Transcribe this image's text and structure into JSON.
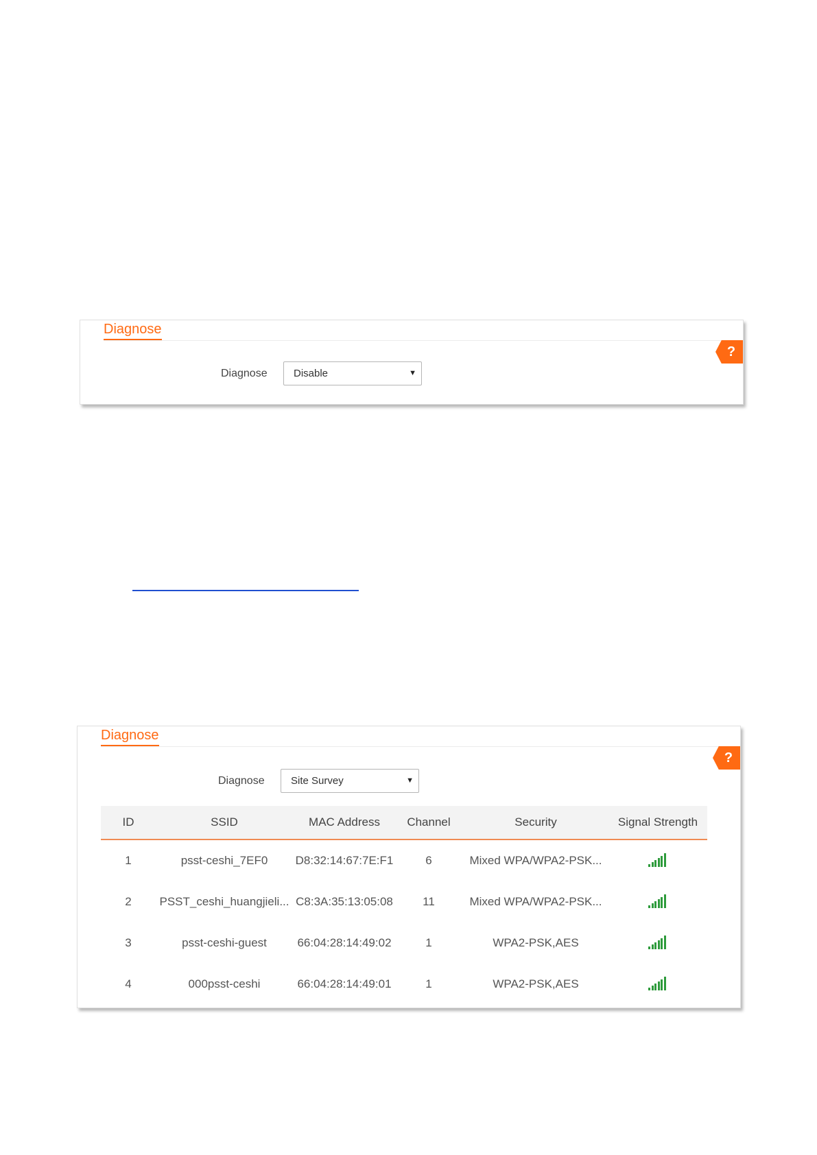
{
  "panel_top": {
    "title": "Diagnose",
    "help": "?",
    "field_label": "Diagnose",
    "select_value": "Disable"
  },
  "panel_bottom": {
    "title": "Diagnose",
    "help": "?",
    "field_label": "Diagnose",
    "select_value": "Site Survey",
    "table": {
      "headers": [
        "ID",
        "SSID",
        "MAC Address",
        "Channel",
        "Security",
        "Signal Strength"
      ],
      "rows": [
        {
          "id": "1",
          "ssid": "psst-ceshi_7EF0",
          "mac": "D8:32:14:67:7E:F1",
          "channel": "6",
          "security": "Mixed WPA/WPA2-PSK...",
          "signal_icon": "signal-full-icon"
        },
        {
          "id": "2",
          "ssid": "PSST_ceshi_huangjieli...",
          "mac": "C8:3A:35:13:05:08",
          "channel": "11",
          "security": "Mixed WPA/WPA2-PSK...",
          "signal_icon": "signal-full-icon"
        },
        {
          "id": "3",
          "ssid": "psst-ceshi-guest",
          "mac": "66:04:28:14:49:02",
          "channel": "1",
          "security": "WPA2-PSK,AES",
          "signal_icon": "signal-full-icon"
        },
        {
          "id": "4",
          "ssid": "000psst-ceshi",
          "mac": "66:04:28:14:49:01",
          "channel": "1",
          "security": "WPA2-PSK,AES",
          "signal_icon": "signal-full-icon"
        }
      ]
    }
  },
  "colors": {
    "accent": "#ff6a13",
    "signal": "#2e9b3c",
    "link": "#1f4fd0"
  }
}
